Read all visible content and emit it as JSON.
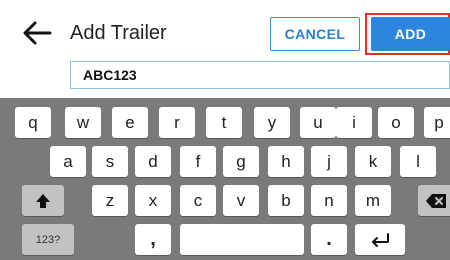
{
  "header": {
    "title": "Add Trailer",
    "cancel_label": "CANCEL",
    "add_label": "ADD",
    "back_icon": "arrow-left-icon"
  },
  "input": {
    "value": "ABC123"
  },
  "keyboard": {
    "row1": [
      "q",
      "w",
      "e",
      "r",
      "t",
      "y",
      "u",
      "i",
      "o",
      "p"
    ],
    "row2": [
      "a",
      "s",
      "d",
      "f",
      "g",
      "h",
      "j",
      "k",
      "l"
    ],
    "row3": [
      "z",
      "x",
      "c",
      "v",
      "b",
      "n",
      "m"
    ],
    "row4": {
      "symbols_label": "123?",
      "comma_label": ",",
      "period_label": "."
    },
    "icons": {
      "shift": "shift-icon",
      "backspace": "backspace-icon",
      "enter": "enter-icon"
    }
  },
  "colors": {
    "accent": "#2d86dc",
    "highlight_outline": "#e0302a",
    "keyboard_bg": "#7a7a7a",
    "key_bg": "#ffffff",
    "mod_key_bg": "#c2c2c2"
  }
}
